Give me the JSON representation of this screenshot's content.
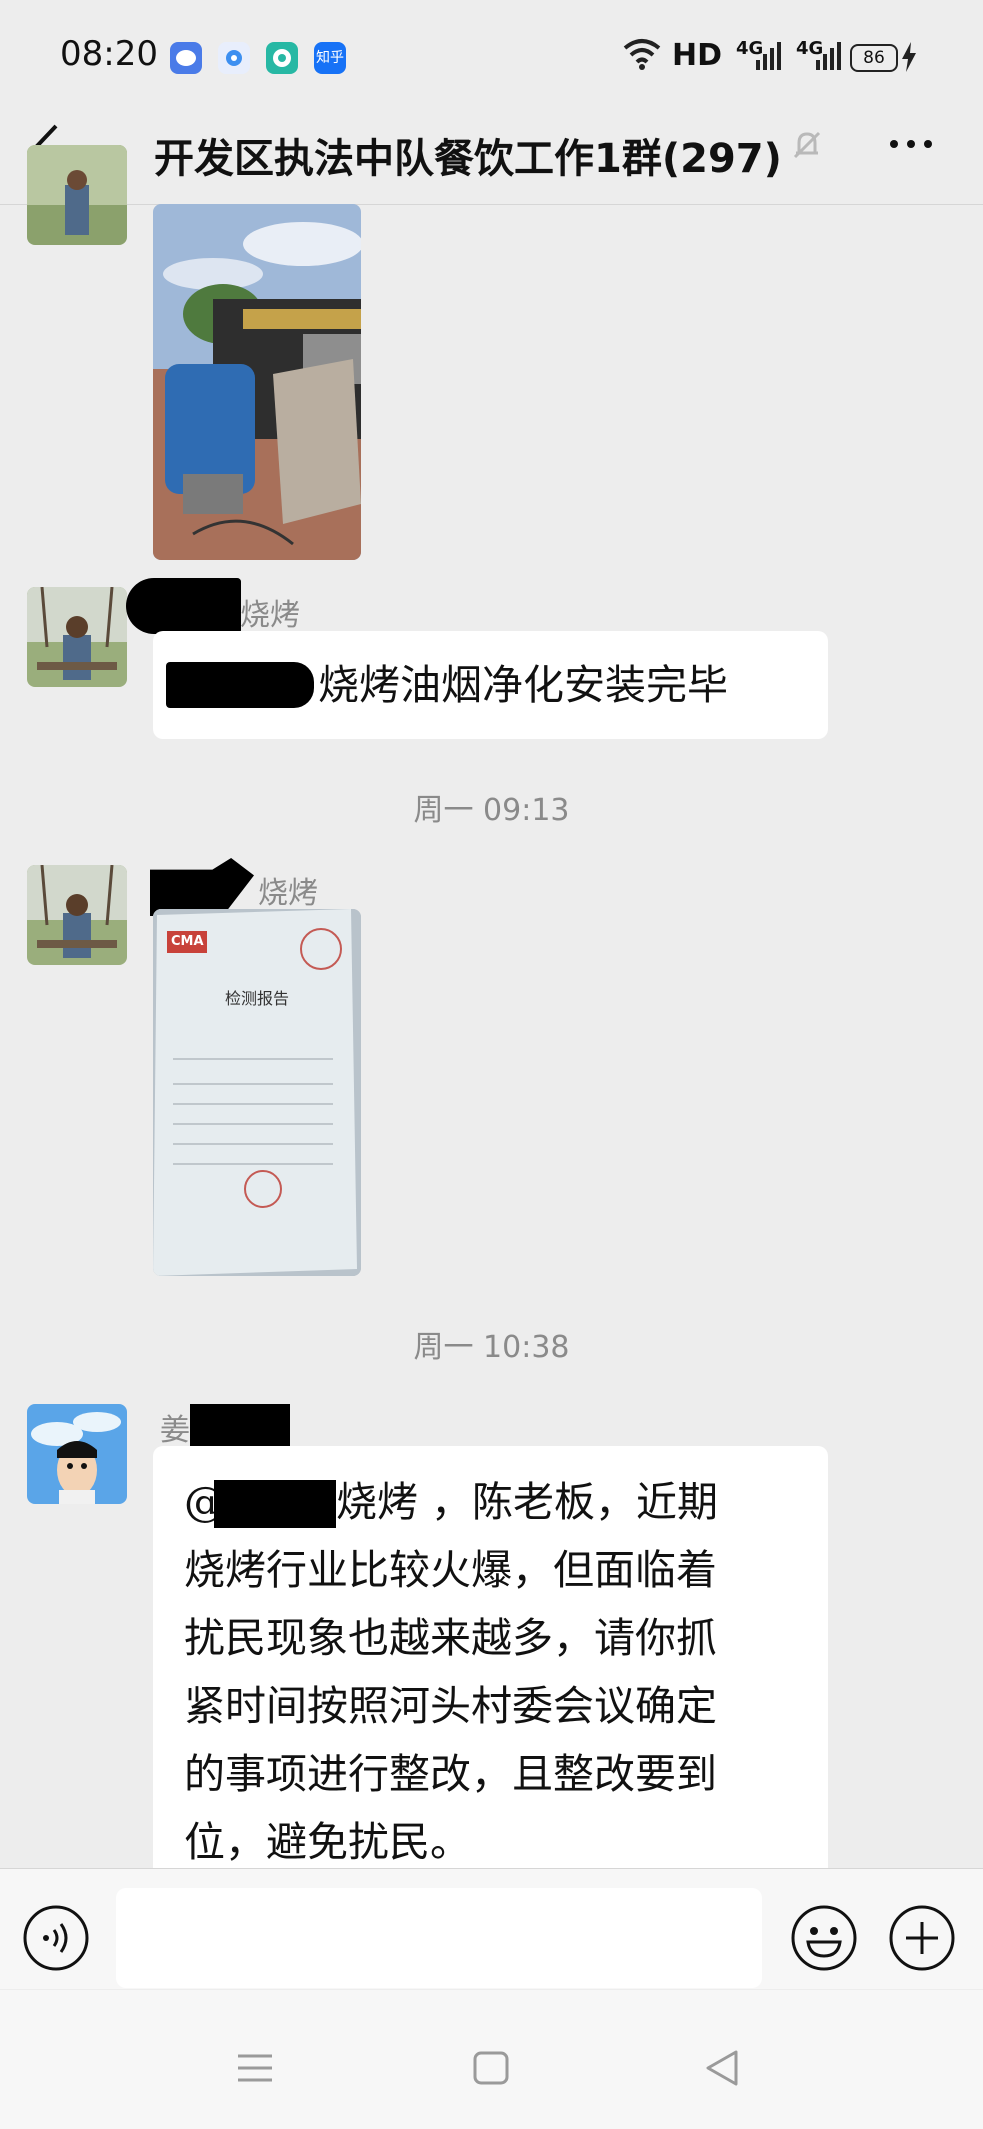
{
  "status_bar": {
    "time": "08:20",
    "app_icons": [
      {
        "name": "chat-app-icon",
        "color": "#4a7be8"
      },
      {
        "name": "browser-app-icon",
        "color": "#3d8ff0"
      },
      {
        "name": "message-app-icon",
        "color": "#27b8a4"
      },
      {
        "name": "zhihu-app-icon",
        "color": "#1772f6"
      }
    ],
    "zhihu_label": "知乎",
    "hd_label": "HD",
    "signal_1": "4G",
    "signal_2": "4G",
    "battery": "86"
  },
  "header": {
    "title": "开发区执法中队餐饮工作1群(297)",
    "back_icon": "chevron-left-icon",
    "mute_icon": "bell-off-icon",
    "more_icon": "more-icon"
  },
  "messages": [
    {
      "type": "image",
      "description_icon": "photo-icon"
    },
    {
      "sender_suffix": "烧烤",
      "text": "烧烤油烟净化安装完毕"
    },
    {
      "timestamp": "周一 09:13"
    },
    {
      "sender_suffix": "烧烤",
      "type": "image",
      "report_title": "检测报告",
      "report_badge": "CMA"
    },
    {
      "timestamp": "周一 10:38"
    },
    {
      "sender_prefix": "姜",
      "lines": [
        "@[redacted]烧烤 ，陈老板，近期",
        "烧烤行业比较火爆，但面临着",
        "扰民现象也越来越多，请你抓",
        "紧时间按照河头村委会议确定",
        "的事项进行整改，且整改要到",
        "位，避免扰民。"
      ],
      "line_1_at": "@",
      "line_1_rest": "烧烤 ，陈老板，近期"
    }
  ],
  "input_bar": {
    "voice_icon": "voice-icon",
    "emoji_icon": "emoji-icon",
    "plus_icon": "plus-icon"
  },
  "nav_bar": {
    "menu_icon": "menu-icon",
    "home_icon": "home-icon",
    "back_icon": "back-triangle-icon"
  }
}
